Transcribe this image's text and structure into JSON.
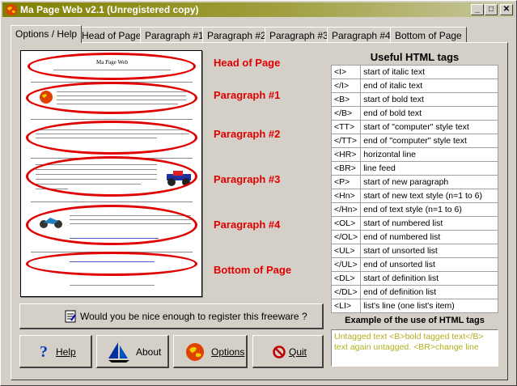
{
  "window": {
    "title": "Ma Page Web v2.1 (Unregistered copy)",
    "min": "_",
    "max": "□",
    "close": "✕"
  },
  "tabs": [
    "Options / Help",
    "Head of Page",
    "Paragraph #1",
    "Paragraph #2",
    "Paragraph #3",
    "Paragraph #4",
    "Bottom of Page"
  ],
  "preview": {
    "head_text": "Ma Page Web"
  },
  "sections": [
    "Head of Page",
    "Paragraph #1",
    "Paragraph #2",
    "Paragraph #3",
    "Paragraph #4",
    "Bottom of Page"
  ],
  "tags_title": "Useful HTML tags",
  "tags": [
    {
      "tag": "<I>",
      "desc": "start of italic text"
    },
    {
      "tag": "</I>",
      "desc": "end of italic text"
    },
    {
      "tag": "<B>",
      "desc": "start of bold text"
    },
    {
      "tag": "</B>",
      "desc": "end of bold text"
    },
    {
      "tag": "<TT>",
      "desc": "start of \"computer\" style text"
    },
    {
      "tag": "</TT>",
      "desc": "end of \"computer\" style text"
    },
    {
      "tag": "<HR>",
      "desc": "horizontal line"
    },
    {
      "tag": "<BR>",
      "desc": "line feed"
    },
    {
      "tag": "<P>",
      "desc": "start of new paragraph"
    },
    {
      "tag": "<Hn>",
      "desc": "start of new text style (n=1 to 6)"
    },
    {
      "tag": "</Hn>",
      "desc": "end of text style (n=1 to 6)"
    },
    {
      "tag": "<OL>",
      "desc": "start of numbered list"
    },
    {
      "tag": "</OL>",
      "desc": "end of numbered list"
    },
    {
      "tag": "<UL>",
      "desc": "start of unsorted list"
    },
    {
      "tag": "</UL>",
      "desc": "end of unsorted list"
    },
    {
      "tag": "<DL>",
      "desc": "start of definition list"
    },
    {
      "tag": "</DL>",
      "desc": "end of definition list"
    },
    {
      "tag": "<LI>",
      "desc": "list's line (one list's item)"
    }
  ],
  "example_title": "Example of the use of HTML tags",
  "example_text": "Untagged text <B>bold tagged text</B> text again untagged. <BR>change line",
  "register_button": "Would you be nice enough to register this freeware ?",
  "buttons": {
    "help": "Help",
    "about": "About",
    "options": "Options",
    "quit": "Quit"
  },
  "colors": {
    "section_label": "#e00000",
    "example_text": "#b0b020",
    "title_bar": "#808000"
  }
}
